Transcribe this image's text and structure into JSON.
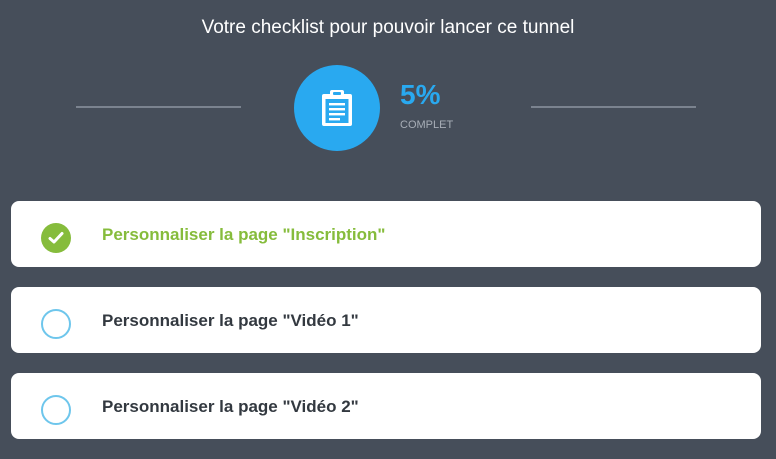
{
  "header": {
    "title": "Votre checklist pour pouvoir lancer ce tunnel"
  },
  "progress": {
    "percent_text": "5%",
    "percent_value": 5,
    "status_label": "COMPLET",
    "icon": "clipboard-icon"
  },
  "checklist": {
    "items": [
      {
        "label": "Personnaliser la page \"Inscription\"",
        "done": true
      },
      {
        "label": "Personnaliser la page \"Vidéo 1\"",
        "done": false
      },
      {
        "label": "Personnaliser la page \"Vidéo 2\"",
        "done": false
      }
    ]
  },
  "colors": {
    "background": "#464e5a",
    "accent_blue": "#29a9f0",
    "done_green": "#86bc3c",
    "todo_circle": "#6ec6ec"
  }
}
